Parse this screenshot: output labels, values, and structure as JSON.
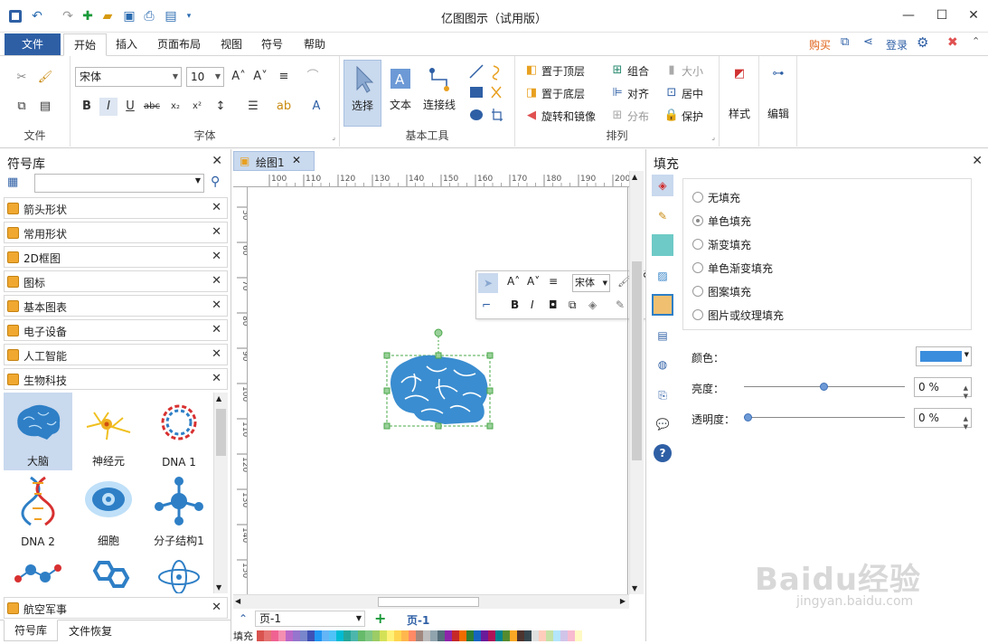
{
  "app": {
    "title": "亿图图示（试用版）"
  },
  "menu": {
    "file": "文件",
    "tabs": [
      "开始",
      "插入",
      "页面布局",
      "视图",
      "符号",
      "帮助"
    ],
    "right": {
      "buy": "购买",
      "login": "登录"
    }
  },
  "ribbon": {
    "file_group": "文件",
    "font_group": "字体",
    "font_name": "宋体",
    "font_size": "10",
    "basic_tools_group": "基本工具",
    "select": "选择",
    "text": "文本",
    "connector": "连接线",
    "arrange_group": "排列",
    "bring_front": "置于顶层",
    "send_back": "置于底层",
    "rotate_mirror": "旋转和镜像",
    "group": "组合",
    "align": "对齐",
    "distribute": "分布",
    "size": "大小",
    "center": "居中",
    "protect": "保护",
    "style": "样式",
    "edit": "编辑"
  },
  "library": {
    "title": "符号库",
    "categories": [
      "箭头形状",
      "常用形状",
      "2D框图",
      "图标",
      "基本图表",
      "电子设备",
      "人工智能",
      "生物科技"
    ],
    "symbols": [
      "大脑",
      "神经元",
      "DNA 1",
      "DNA 2",
      "细胞",
      "分子结构1"
    ],
    "bottom_category": "航空军事",
    "tabs": [
      "符号库",
      "文件恢复"
    ]
  },
  "document": {
    "tab": "绘图1",
    "page_select": "页-1",
    "page_tab": "页-1",
    "fill_label": "填充",
    "ruler_h": [
      "100",
      "110",
      "120",
      "130",
      "140",
      "150",
      "160",
      "170",
      "180",
      "190",
      "200"
    ],
    "ruler_v": [
      "50",
      "60",
      "70",
      "80",
      "90",
      "100",
      "110",
      "120",
      "130",
      "140",
      "150",
      "160"
    ],
    "float_font": "宋体"
  },
  "fill_panel": {
    "title": "填充",
    "options": [
      "无填充",
      "单色填充",
      "渐变填充",
      "单色渐变填充",
      "图案填充",
      "图片或纹理填充"
    ],
    "selected_index": 1,
    "color_label": "颜色：",
    "color_value": "#3a8ddd",
    "brightness_label": "亮度：",
    "brightness_value": "0 %",
    "transparency_label": "透明度：",
    "transparency_value": "0 %"
  },
  "watermark": {
    "brand": "Baidu经验",
    "url": "jingyan.baidu.com"
  }
}
